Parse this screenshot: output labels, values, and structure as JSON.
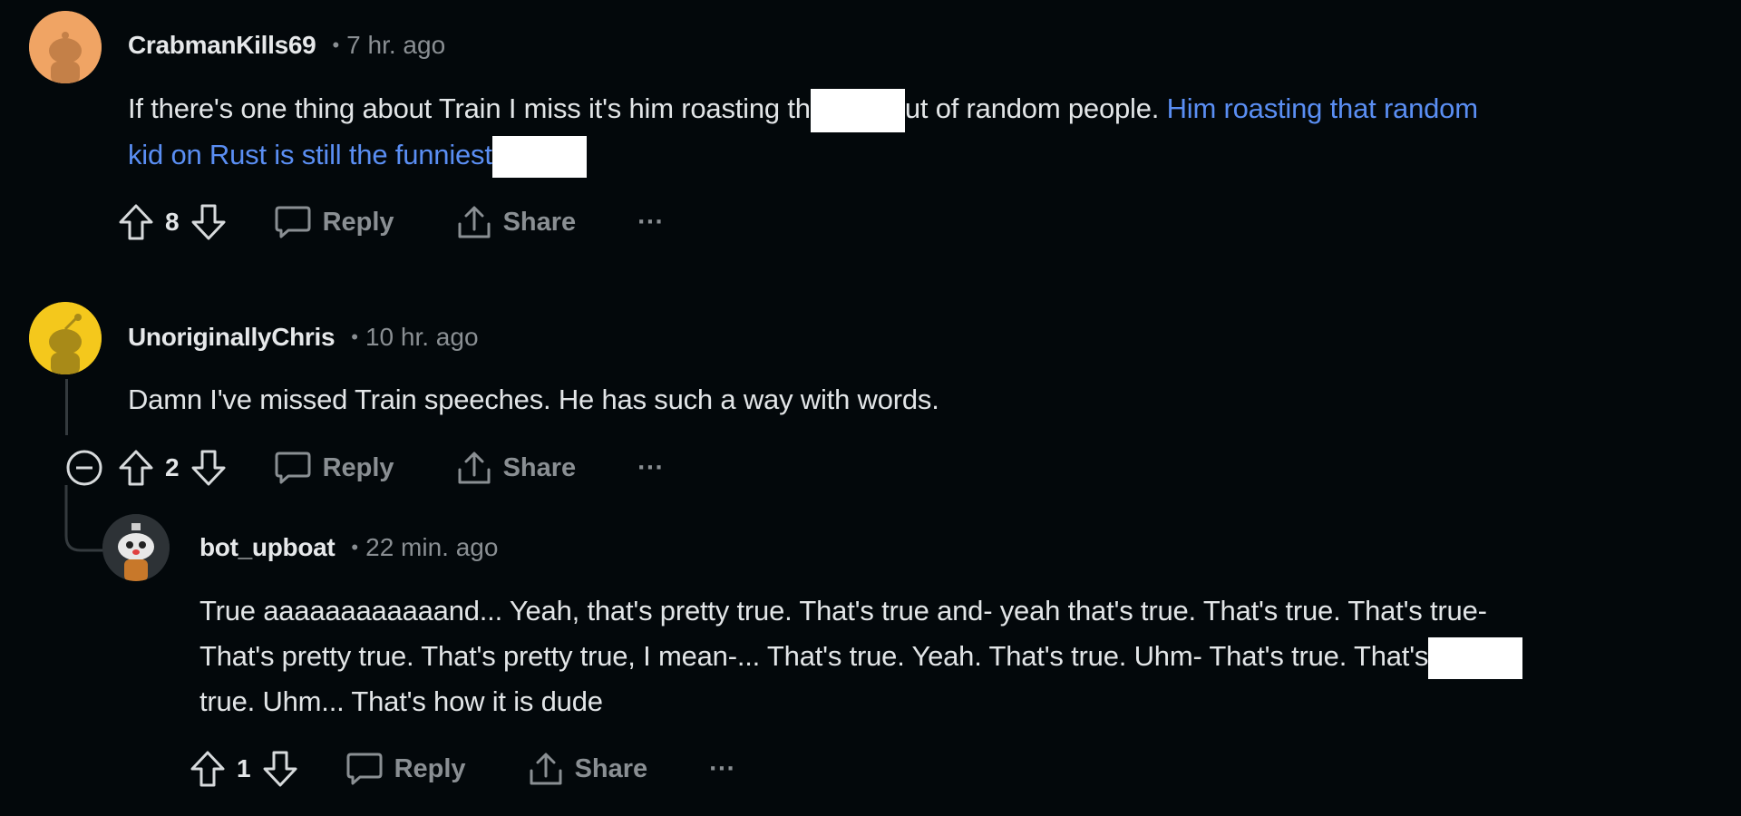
{
  "comments": [
    {
      "username": "CrabmanKills69",
      "separator": "•",
      "time": "7 hr. ago",
      "line1_a": "If there's one thing about Train I miss it's him roasting th",
      "line1_b": "ut of random people. ",
      "line1_link": "Him roasting that random",
      "line2_link": "kid on Rust is still the funniest",
      "votes": "8",
      "reply_label": "Reply",
      "share_label": "Share",
      "more_label": "···",
      "avatar_color": "#f4a261"
    },
    {
      "username": "UnoriginallyChris",
      "separator": "•",
      "time": "10 hr. ago",
      "line1": "Damn I've missed Train speeches. He has such a way with words.",
      "votes": "2",
      "reply_label": "Reply",
      "share_label": "Share",
      "more_label": "···",
      "avatar_color": "#f2c418"
    },
    {
      "username": "bot_upboat",
      "separator": "•",
      "time": "22 min. ago",
      "line1": "True aaaaaaaaaaaand... Yeah, that's pretty true. That's true and- yeah that's true. That's true. That's true-",
      "line2_a": "That's pretty true. That's pretty true, I mean-... That's true. Yeah. That's true. Uhm- That's true. That's",
      "line3": "true. Uhm... That's how it is dude",
      "votes": "1",
      "reply_label": "Reply",
      "share_label": "Share",
      "more_label": "···"
    }
  ],
  "icons": {
    "upvote": "arrow-up-icon",
    "downvote": "arrow-down-icon",
    "reply": "speech-bubble-icon",
    "share": "share-icon",
    "collapse": "minus-circle-icon",
    "more": "ellipsis-icon"
  }
}
